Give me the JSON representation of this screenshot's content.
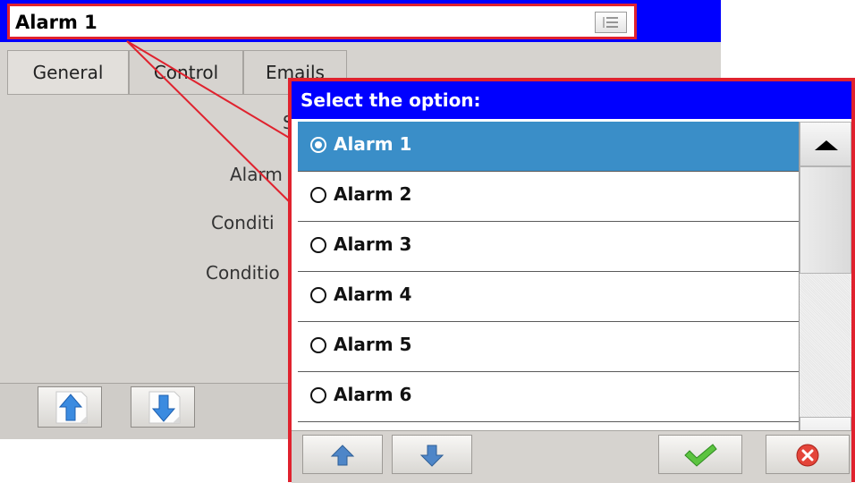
{
  "window": {
    "title": "Alarm 1",
    "tabs": [
      "General",
      "Control",
      "Emails"
    ],
    "form_labels": [
      "S",
      "Alarm",
      "Conditi",
      "Conditio"
    ]
  },
  "dialog": {
    "title": "Select the option:",
    "selected_index": 0,
    "options": [
      "Alarm 1",
      "Alarm 2",
      "Alarm 3",
      "Alarm 4",
      "Alarm 5",
      "Alarm 6"
    ]
  },
  "icons": {
    "title_menu": "list-icon",
    "bg_up": "arrow-up-icon",
    "bg_down": "arrow-down-icon",
    "scroll_up": "triangle-up-icon",
    "scroll_down": "triangle-down-icon",
    "dlg_up": "arrow-up-icon",
    "dlg_down": "arrow-down-icon",
    "confirm": "checkmark-icon",
    "cancel": "close-icon"
  },
  "colors": {
    "title_bar": "#0000ff",
    "highlight_border": "#e0222e",
    "selected_row": "#3a8ec8"
  }
}
